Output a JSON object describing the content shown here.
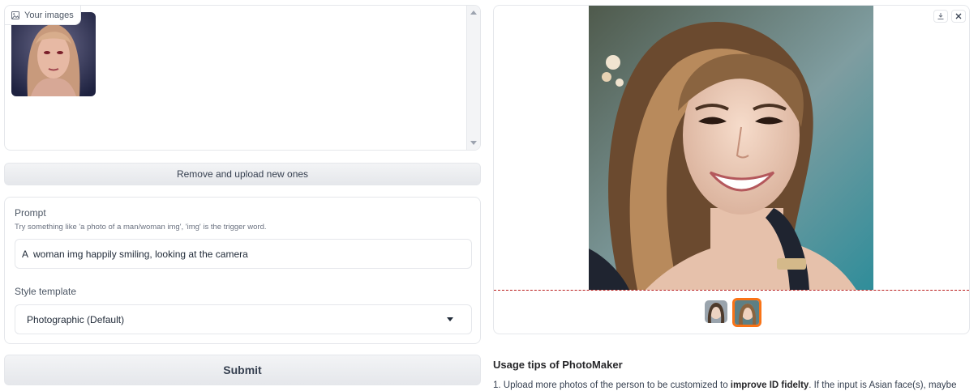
{
  "input_gallery": {
    "label": "Your images",
    "label_icon": "image-icon",
    "images": [
      {
        "icon": "uploaded-photo"
      }
    ]
  },
  "remove_button": "Remove and upload new ones",
  "prompt": {
    "label": "Prompt",
    "info": "Try something like 'a photo of a man/woman img', 'img' is the trigger word.",
    "value": "A  woman img happily smiling, looking at the camera"
  },
  "style": {
    "label": "Style template",
    "selected": "Photographic (Default)"
  },
  "submit_button": "Submit",
  "output_gallery": {
    "download_icon": "download-icon",
    "close_icon": "close-icon",
    "thumbnails": [
      {
        "selected": false
      },
      {
        "selected": true
      }
    ],
    "accent": "#f97316"
  },
  "tips": {
    "title": "Usage tips of PhotoMaker",
    "line1_pre": "1. Upload more photos of the person to be customized to ",
    "line1_bold": "improve ID fidelty",
    "line1_post": ". If the input is Asian face(s), maybe"
  }
}
